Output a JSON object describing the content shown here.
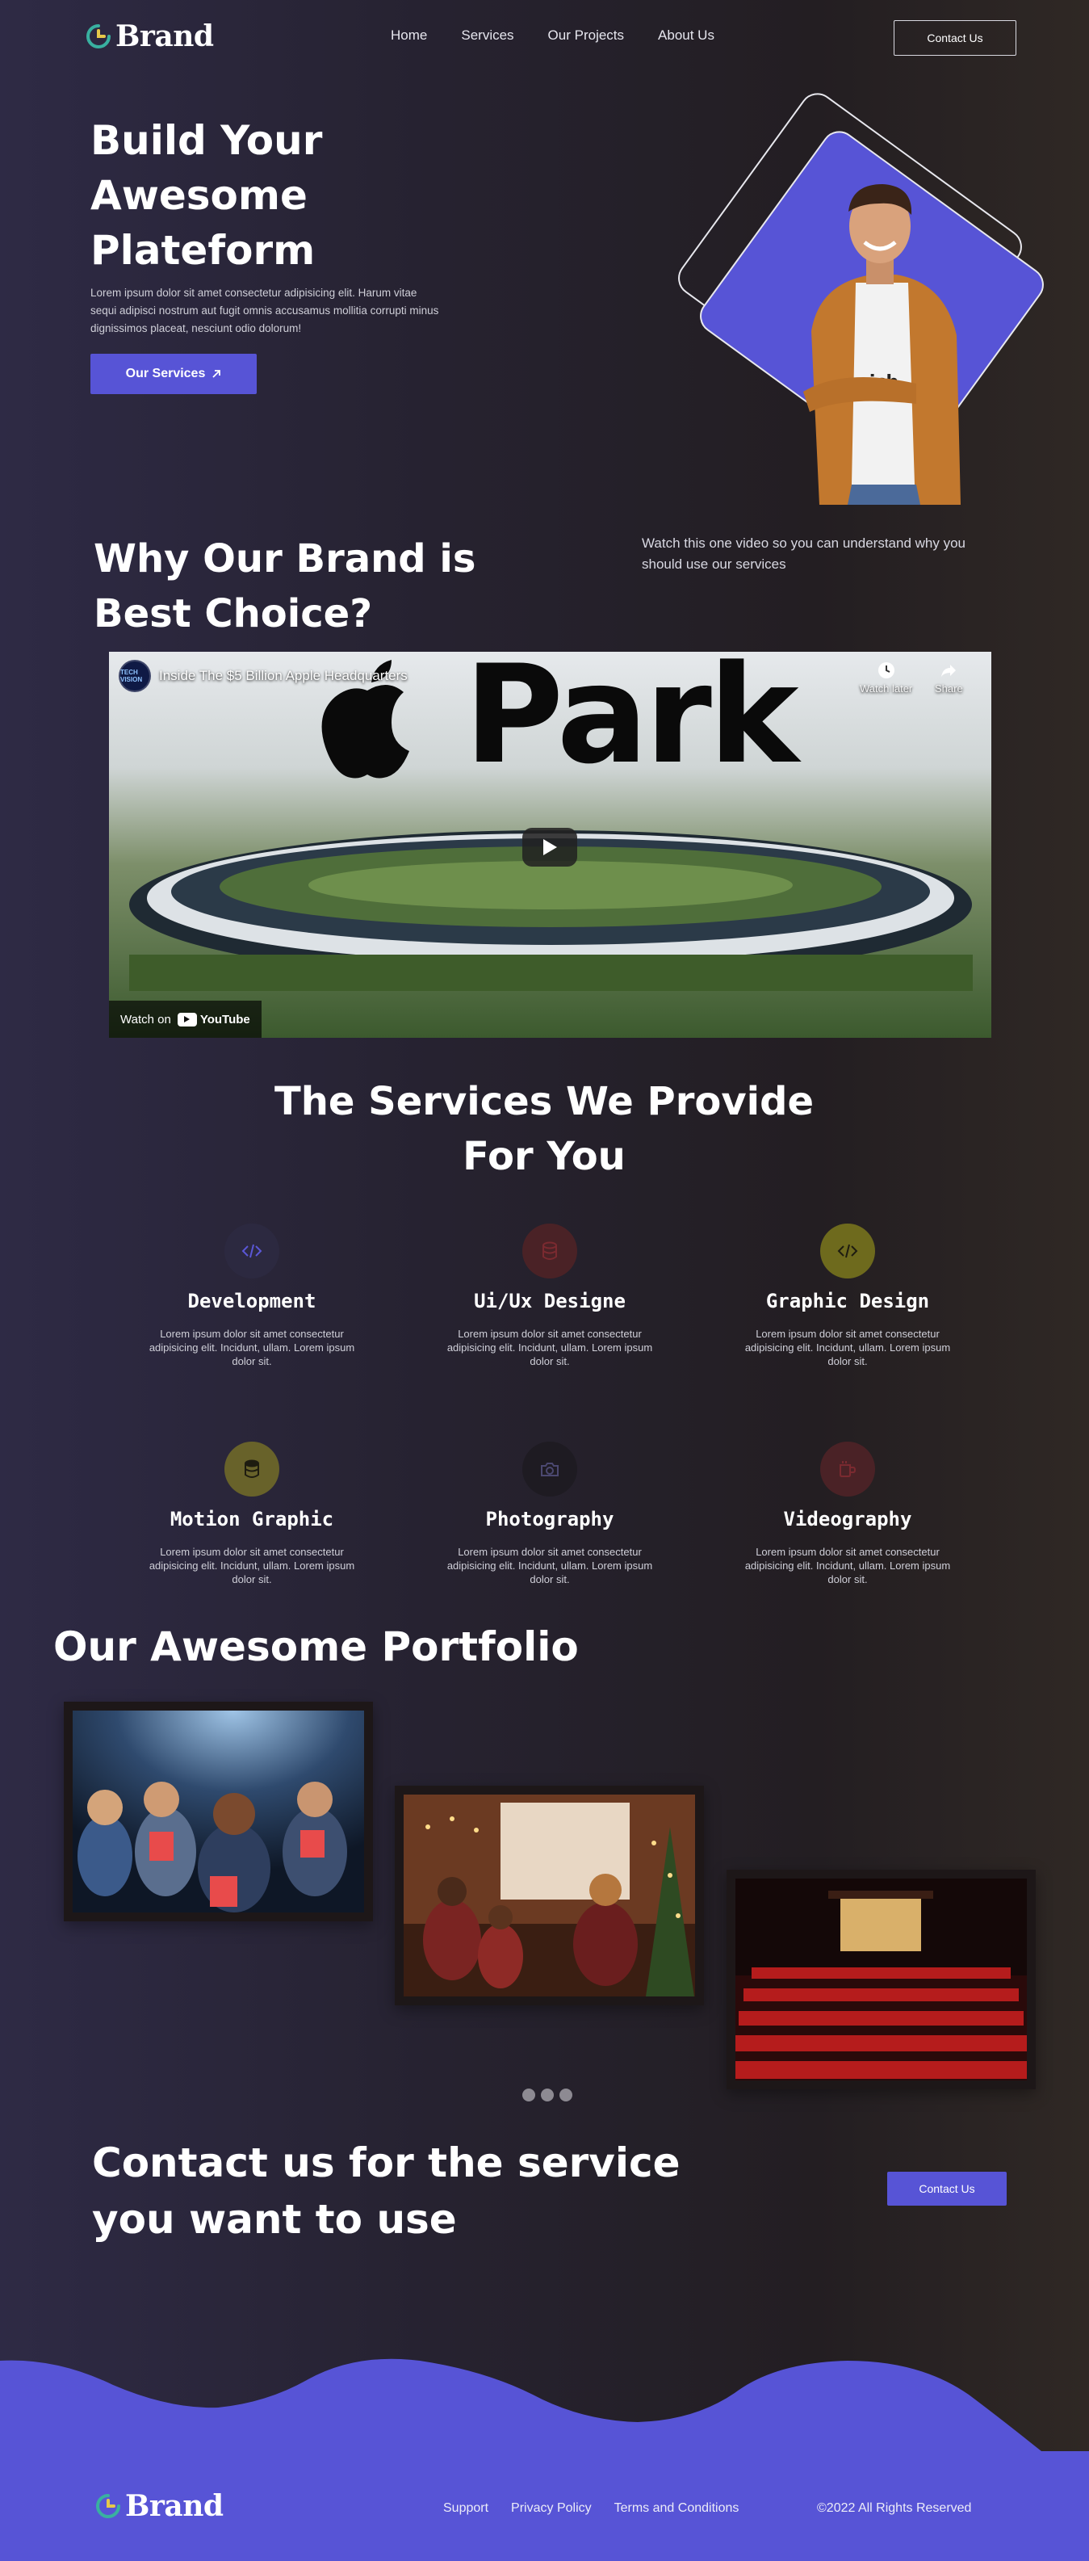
{
  "brand": {
    "name": "Brand"
  },
  "nav": {
    "items": [
      "Home",
      "Services",
      "Our Projects",
      "About Us"
    ],
    "contact_label": "Contact Us"
  },
  "hero": {
    "title": "Build Your Awesome Plateform",
    "text": "Lorem ipsum dolor sit amet consectetur adipisicing elit. Harum vitae sequi adipisci nostrum aut fugit omnis accusamus mollitia corrupti minus dignissimos placeat, nesciunt odio dolorum!",
    "button_label": "Our Services"
  },
  "why": {
    "title": "Why Our Brand is Best Choice?",
    "text": "Watch this one video so you can understand why you should use our services"
  },
  "video": {
    "channel_badge": "TECH VISION",
    "title": "Inside The $5 Billion Apple Headquarters",
    "watch_later": "Watch later",
    "share": "Share",
    "watch_on": "Watch on",
    "youtube": "YouTube",
    "headline": "Park"
  },
  "services": {
    "title": "The Services We Provide For You",
    "items": [
      {
        "name": "Development",
        "desc": "Lorem ipsum dolor sit amet consectetur adipisicing elit. Incidunt, ullam. Lorem ipsum dolor sit.",
        "icon": "code-icon",
        "color": "#2c2940",
        "glyph_color": "#5b57d6"
      },
      {
        "name": "Ui/Ux Designe",
        "desc": "Lorem ipsum dolor sit amet consectetur adipisicing elit. Incidunt, ullam. Lorem ipsum dolor sit.",
        "icon": "database-icon",
        "color": "#4a2226",
        "glyph_color": "#7a2a30"
      },
      {
        "name": "Graphic Design",
        "desc": "Lorem ipsum dolor sit amet consectetur adipisicing elit. Incidunt, ullam. Lorem ipsum dolor sit.",
        "icon": "code-icon",
        "color": "#6e6a1d",
        "glyph_color": "#1e1c10"
      },
      {
        "name": "Motion Graphic",
        "desc": "Lorem ipsum dolor sit amet consectetur adipisicing elit. Incidunt, ullam. Lorem ipsum dolor sit.",
        "icon": "database-icon",
        "color": "#68622a",
        "glyph_color": "#1e1c10"
      },
      {
        "name": "Photography",
        "desc": "Lorem ipsum dolor sit amet consectetur adipisicing elit. Incidunt, ullam. Lorem ipsum dolor sit.",
        "icon": "camera-icon",
        "color": "#1e1b22",
        "glyph_color": "#4b4870"
      },
      {
        "name": "Videography",
        "desc": "Lorem ipsum dolor sit amet consectetur adipisicing elit. Incidunt, ullam. Lorem ipsum dolor sit.",
        "icon": "mug-icon",
        "color": "#4a2226",
        "glyph_color": "#7a2a30"
      }
    ]
  },
  "portfolio": {
    "title": "Our Awesome Portfolio"
  },
  "contact": {
    "title": "Contact us for the service you want to use",
    "button_label": "Contact Us"
  },
  "footer": {
    "links": [
      "Support",
      "Privacy Policy",
      "Terms and Conditions"
    ],
    "copyright": "©2022 All Rights Reserved"
  },
  "colors": {
    "accent": "#5754d6",
    "logo_teal": "#39b0a0",
    "logo_yellow": "#e6c84a"
  }
}
